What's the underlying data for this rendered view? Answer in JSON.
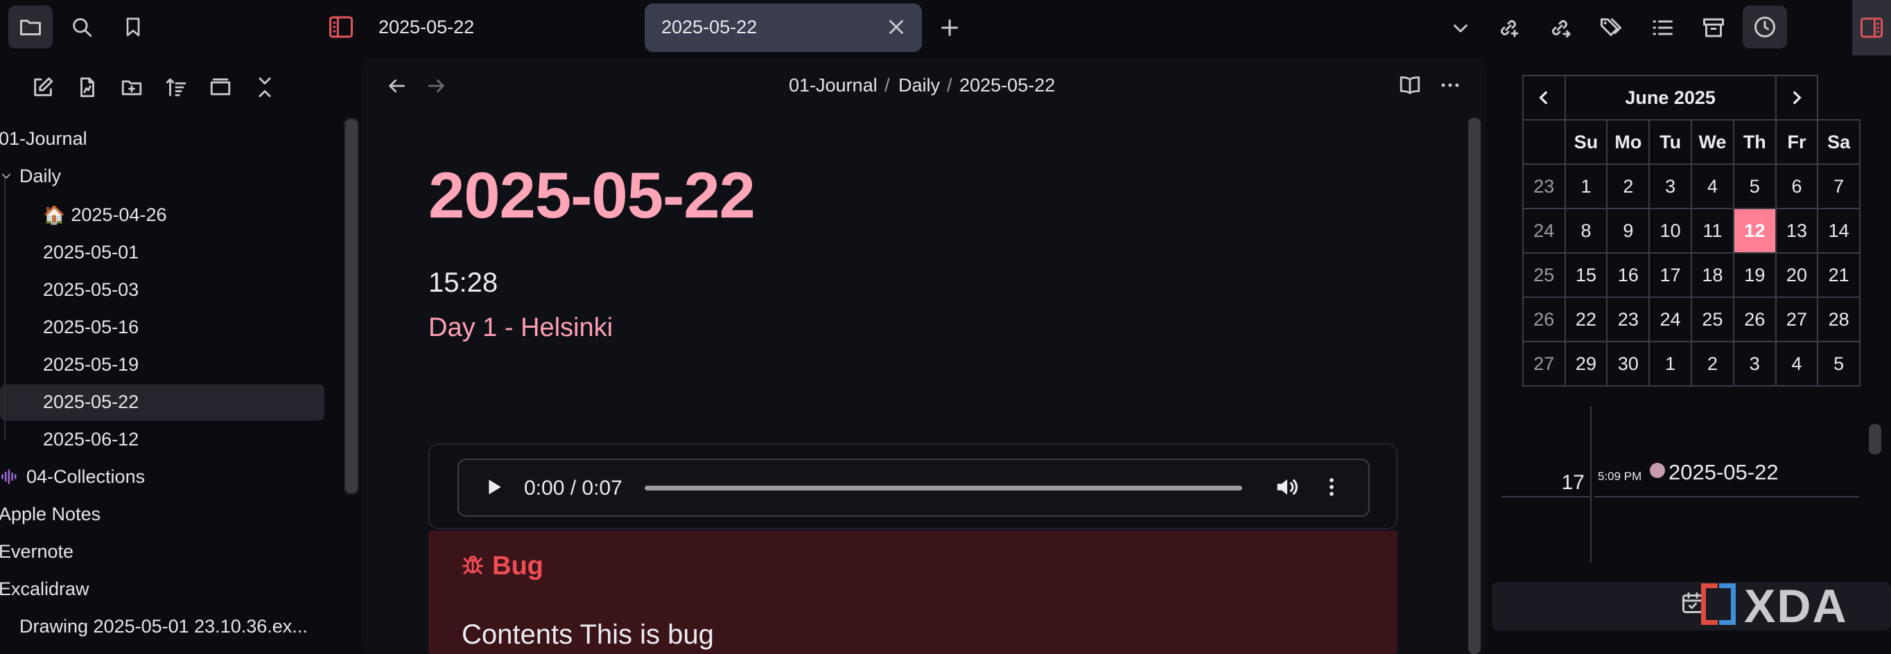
{
  "tabs": {
    "first_tab": "2025-05-22",
    "active_tab": "2025-05-22"
  },
  "breadcrumb": {
    "part1": "01-Journal",
    "part2": "Daily",
    "part3": "2025-05-22",
    "sep": "/"
  },
  "sidebar": {
    "items": [
      {
        "label": "01-Journal"
      },
      {
        "label": "Daily"
      },
      {
        "label": "2025-04-26",
        "emoji": "🏠"
      },
      {
        "label": "2025-05-01"
      },
      {
        "label": "2025-05-03"
      },
      {
        "label": "2025-05-16"
      },
      {
        "label": "2025-05-19"
      },
      {
        "label": "2025-05-22"
      },
      {
        "label": "2025-06-12"
      },
      {
        "label": "04-Collections"
      },
      {
        "label": "Apple Notes"
      },
      {
        "label": "Evernote"
      },
      {
        "label": "Excalidraw"
      },
      {
        "label": "Drawing 2025-05-01 23.10.36.ex..."
      }
    ]
  },
  "note": {
    "title": "2025-05-22",
    "time": "15:28",
    "subtitle": "Day 1 - Helsinki",
    "audio_time": "0:00 / 0:07",
    "callout_title": "Bug",
    "callout_body": "Contents This is bug"
  },
  "calendar": {
    "month": "June 2025",
    "weekdays": [
      "Su",
      "Mo",
      "Tu",
      "We",
      "Th",
      "Fr",
      "Sa"
    ],
    "weeks": [
      {
        "wk": "23",
        "days": [
          "1",
          "2",
          "3",
          "4",
          "5",
          "6",
          "7"
        ]
      },
      {
        "wk": "24",
        "days": [
          "8",
          "9",
          "10",
          "11",
          "12",
          "13",
          "14"
        ]
      },
      {
        "wk": "25",
        "days": [
          "15",
          "16",
          "17",
          "18",
          "19",
          "20",
          "21"
        ]
      },
      {
        "wk": "26",
        "days": [
          "22",
          "23",
          "24",
          "25",
          "26",
          "27",
          "28"
        ]
      },
      {
        "wk": "27",
        "days": [
          "29",
          "30",
          "1",
          "2",
          "3",
          "4",
          "5"
        ]
      }
    ],
    "today": "12",
    "accent": "#ff8095"
  },
  "timeline": {
    "day": "17",
    "time": "5:09 PM",
    "note": "2025-05-22"
  },
  "watermark": "XDA",
  "colors": {
    "title": "#ffa5b8",
    "callout_bg": "#3a1419",
    "callout_title": "#f04d55"
  }
}
